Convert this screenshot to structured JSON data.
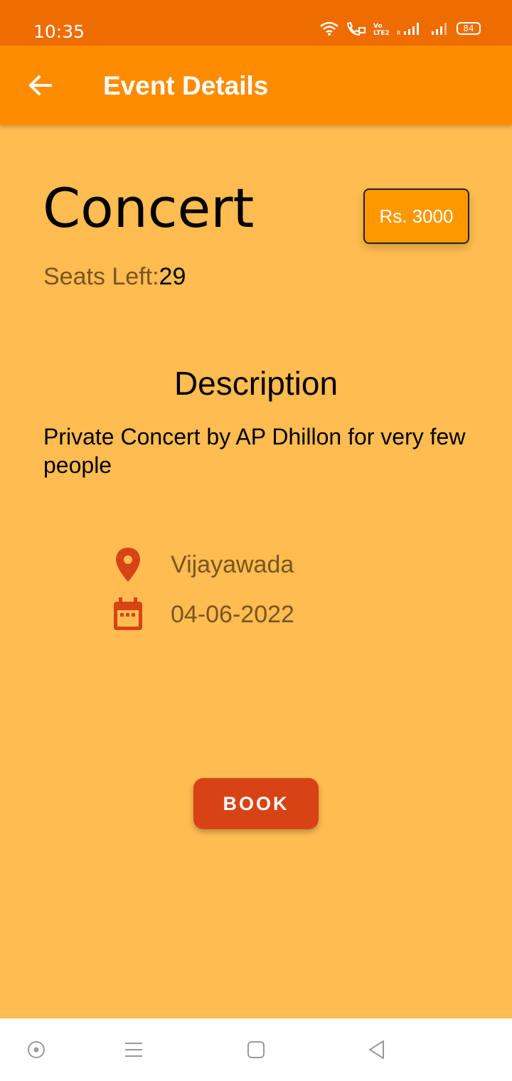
{
  "status_bar": {
    "time": "10:35",
    "battery": "84"
  },
  "app_bar": {
    "title": "Event Details"
  },
  "event": {
    "title": "Concert",
    "price": "Rs. 3000",
    "seats_label": "Seats Left:",
    "seats_value": "29",
    "description_heading": "Description",
    "description": "Private Concert by AP Dhillon for very few people",
    "location": "Vijayawada",
    "date": "04-06-2022"
  },
  "actions": {
    "book_label": "BOOK"
  },
  "colors": {
    "status_bar": "#EE6C00",
    "app_bar": "#FF8C00",
    "background": "#FFBC50",
    "price_button": "#FF9800",
    "book_button": "#D84315",
    "icon": "#D84315"
  },
  "icons": {
    "back": "arrow-left-icon",
    "location": "location-pin-icon",
    "date": "calendar-icon"
  }
}
